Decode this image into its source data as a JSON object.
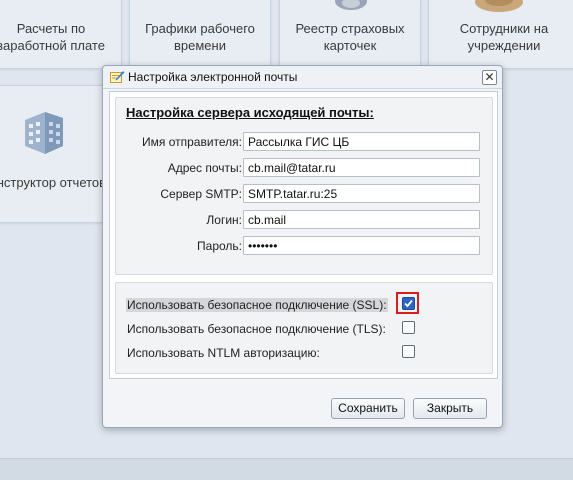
{
  "tiles": [
    {
      "id": "payroll",
      "lines": [
        "Расчеты по",
        "заработной плате"
      ]
    },
    {
      "id": "schedules",
      "lines": [
        "Графики рабочего",
        "времени"
      ]
    },
    {
      "id": "insurance",
      "lines": [
        "Реестр страховых",
        "карточек"
      ]
    },
    {
      "id": "employees",
      "lines": [
        "Сотрудники на",
        "учреждении"
      ]
    },
    {
      "id": "constructor",
      "lines": [
        "Конструктор отчетов"
      ]
    }
  ],
  "dialog": {
    "title": "Настройка электронной почты",
    "close_glyph": "✕",
    "server": {
      "legend": "Настройка сервера исходящей почты:",
      "fields": [
        {
          "label": "Имя отправителя:",
          "value": "Рассылка ГИС ЦБ"
        },
        {
          "label": "Адрес почты:",
          "value": "cb.mail@tatar.ru"
        },
        {
          "label": "Сервер SMTP:",
          "value": "SMTP.tatar.ru:25"
        },
        {
          "label": "Логин:",
          "value": "cb.mail"
        },
        {
          "label": "Пароль:",
          "value": "•••••••"
        }
      ]
    },
    "options": [
      {
        "label": "Использовать безопасное подключение (SSL):",
        "checked": true
      },
      {
        "label": "Использовать безопасное подключение (TLS):",
        "checked": false
      },
      {
        "label": "Использовать NTLM авторизацию:",
        "checked": false
      }
    ],
    "buttons": {
      "save": "Сохранить",
      "close": "Закрыть"
    }
  },
  "colors": {
    "accent": "#2a64c4",
    "highlight_ring": "#e01a1a"
  }
}
